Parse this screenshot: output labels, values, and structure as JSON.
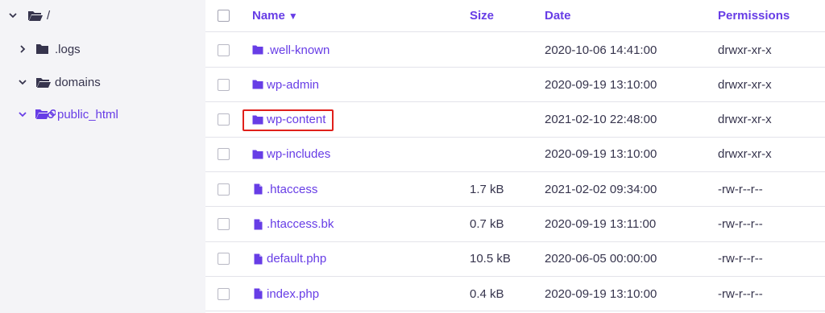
{
  "colors": {
    "accent": "#673de6",
    "text": "#36344d",
    "sidebar_bg": "#f4f4f7",
    "highlight": "#e0201b"
  },
  "sidebar": {
    "items": [
      {
        "label": "/",
        "expanded": true,
        "icon": "folder-open-icon"
      },
      {
        "label": ".logs",
        "expanded": false,
        "icon": "folder-icon"
      },
      {
        "label": "domains",
        "expanded": true,
        "icon": "folder-open-icon"
      },
      {
        "label": "public_html",
        "expanded": true,
        "icon": "folder-link-icon",
        "active": true
      }
    ]
  },
  "table": {
    "headers": {
      "name": "Name",
      "sort_indicator": "▼",
      "size": "Size",
      "date": "Date",
      "permissions": "Permissions"
    },
    "rows": [
      {
        "type": "folder",
        "name": ".well-known",
        "size": "",
        "date": "2020-10-06 14:41:00",
        "permissions": "drwxr-xr-x"
      },
      {
        "type": "folder",
        "name": "wp-admin",
        "size": "",
        "date": "2020-09-19 13:10:00",
        "permissions": "drwxr-xr-x"
      },
      {
        "type": "folder",
        "name": "wp-content",
        "size": "",
        "date": "2021-02-10 22:48:00",
        "permissions": "drwxr-xr-x",
        "highlighted": true
      },
      {
        "type": "folder",
        "name": "wp-includes",
        "size": "",
        "date": "2020-09-19 13:10:00",
        "permissions": "drwxr-xr-x"
      },
      {
        "type": "file",
        "name": ".htaccess",
        "size": "1.7 kB",
        "date": "2021-02-02 09:34:00",
        "permissions": "-rw-r--r--"
      },
      {
        "type": "file",
        "name": ".htaccess.bk",
        "size": "0.7 kB",
        "date": "2020-09-19 13:11:00",
        "permissions": "-rw-r--r--"
      },
      {
        "type": "file",
        "name": "default.php",
        "size": "10.5 kB",
        "date": "2020-06-05 00:00:00",
        "permissions": "-rw-r--r--"
      },
      {
        "type": "file",
        "name": "index.php",
        "size": "0.4 kB",
        "date": "2020-09-19 13:10:00",
        "permissions": "-rw-r--r--"
      }
    ]
  }
}
